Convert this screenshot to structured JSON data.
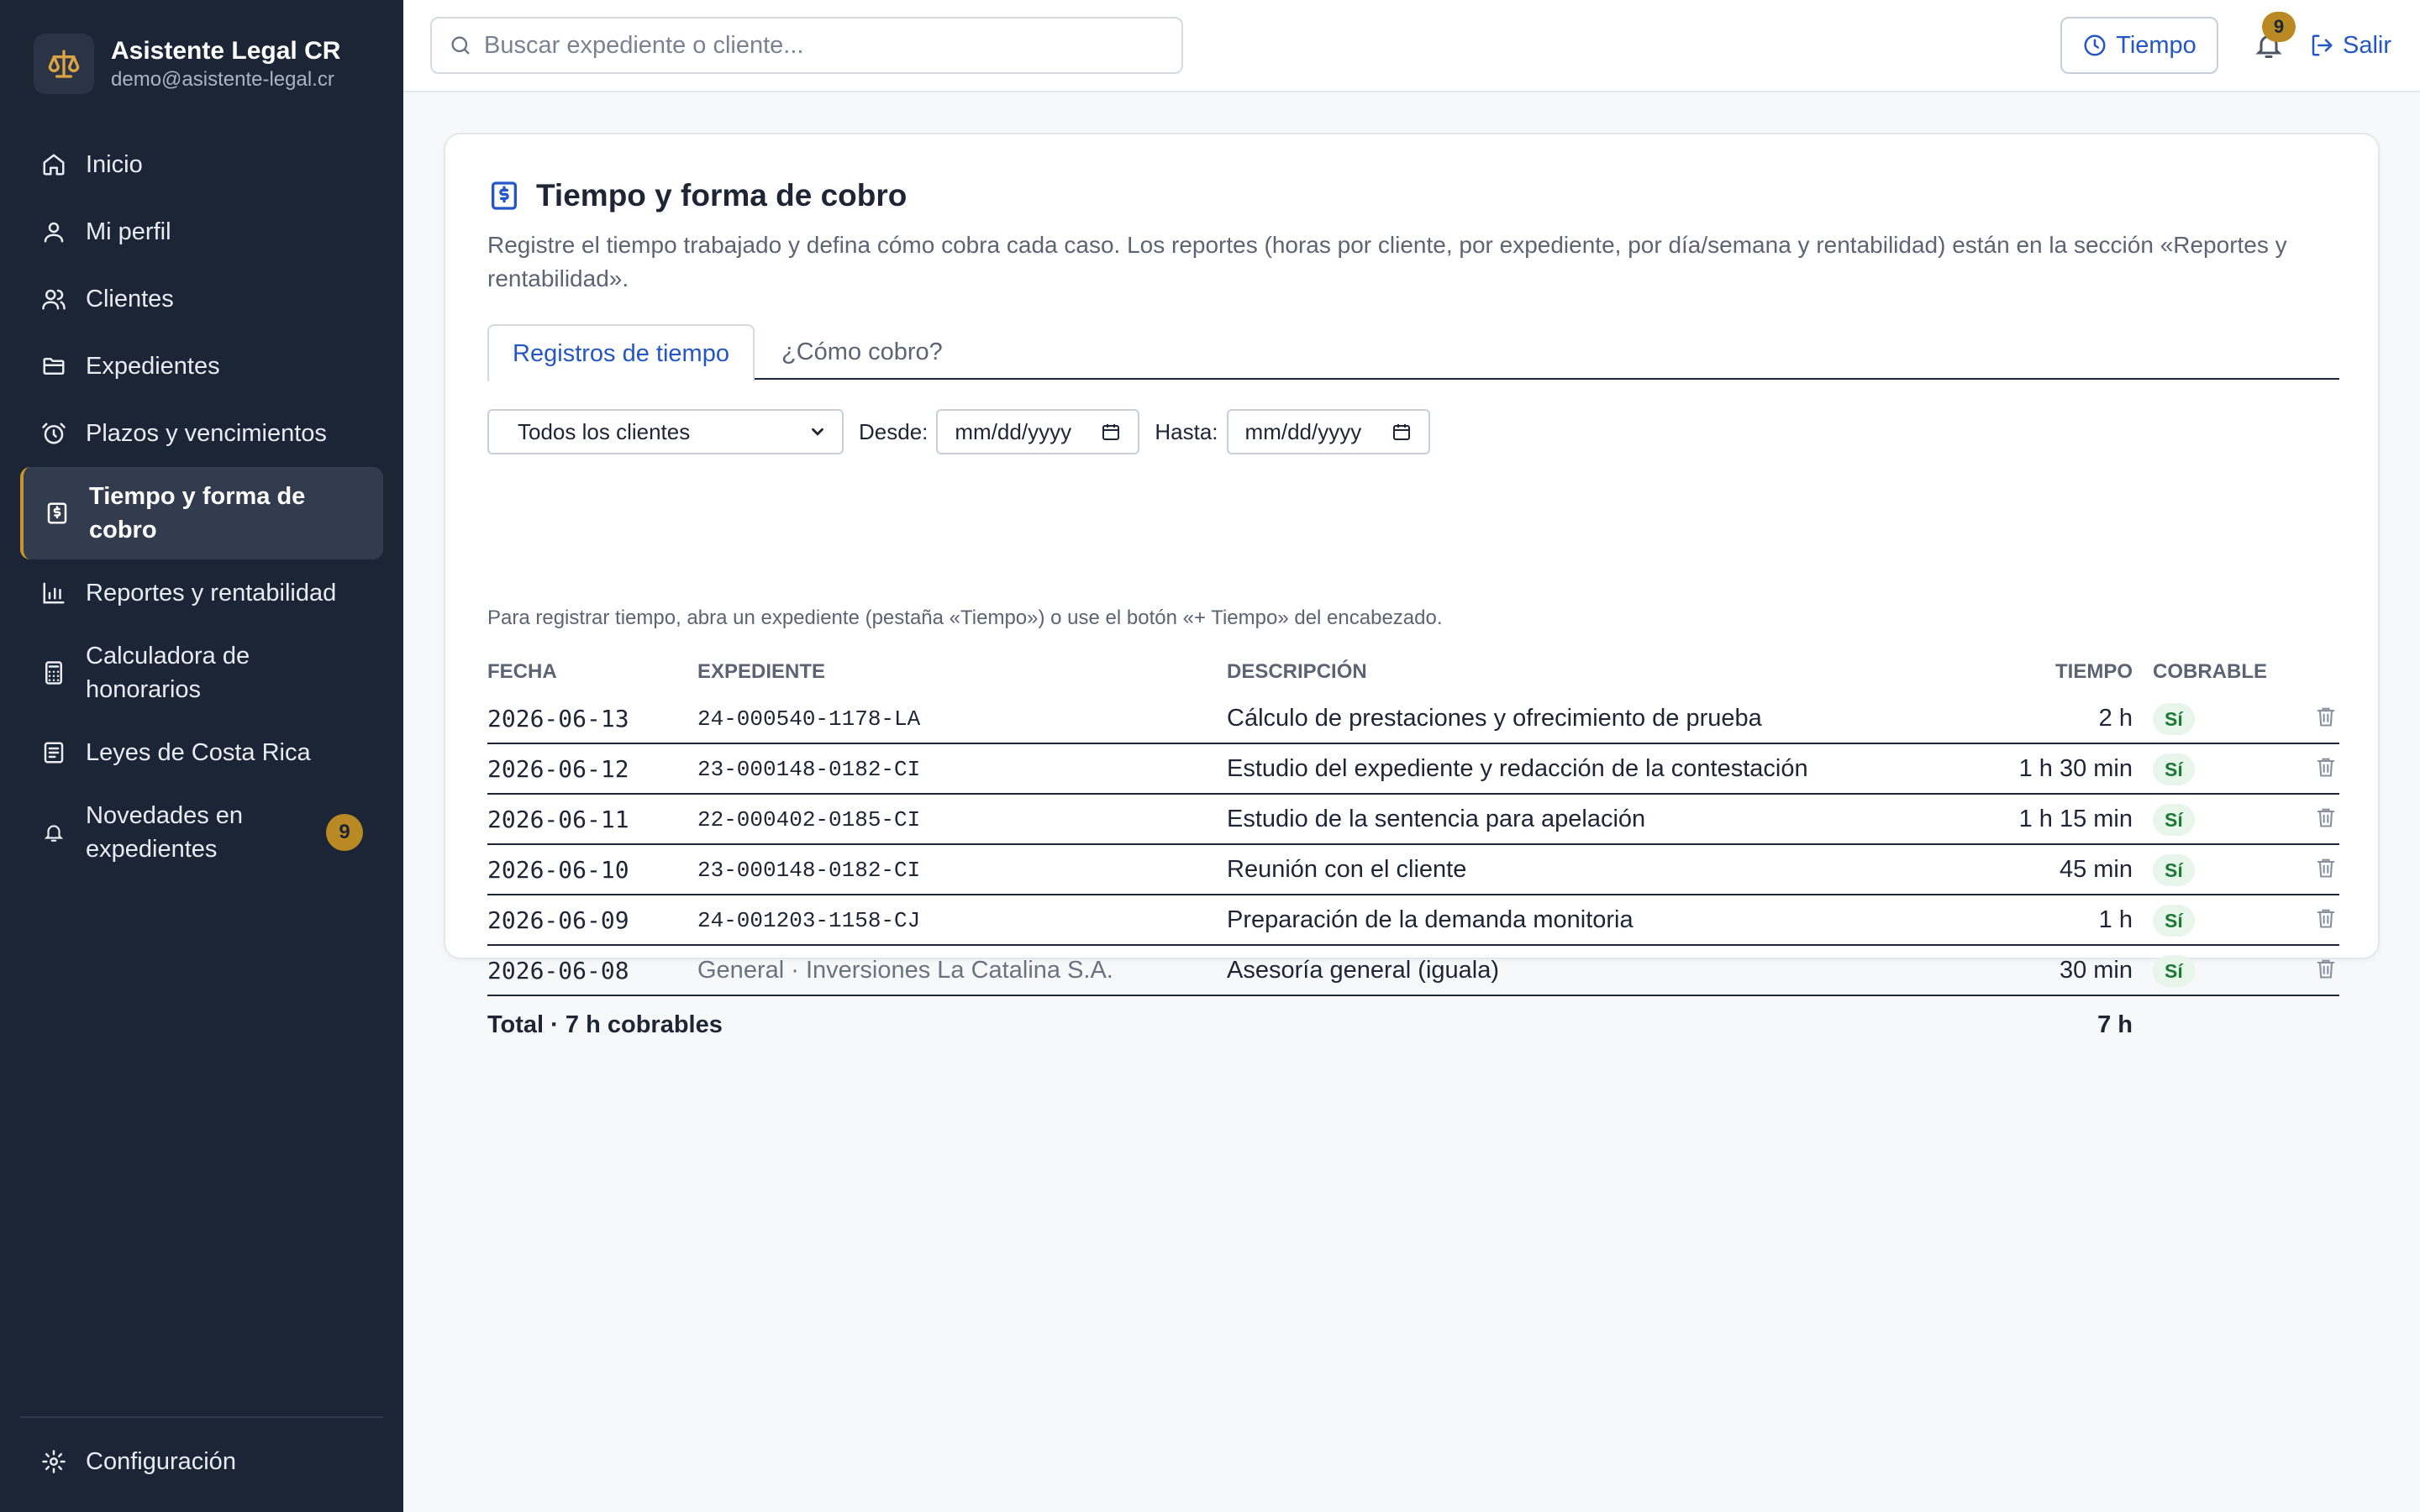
{
  "colors": {
    "sidebar_bg": "#1c2536",
    "accent_gold": "#b98a24",
    "link_blue": "#2457c5",
    "billable_green": "#1d7a34"
  },
  "brand": {
    "title": "Asistente Legal CR",
    "email": "demo@asistente-legal.cr",
    "icon": "scales-icon"
  },
  "sidebar": {
    "items": [
      {
        "label": "Inicio",
        "icon": "home-icon"
      },
      {
        "label": "Mi perfil",
        "icon": "user-icon"
      },
      {
        "label": "Clientes",
        "icon": "users-icon"
      },
      {
        "label": "Expedientes",
        "icon": "folder-icon"
      },
      {
        "label": "Plazos y vencimientos",
        "icon": "alarm-icon"
      },
      {
        "label": "Tiempo y forma de cobro",
        "icon": "receipt-icon",
        "active": true
      },
      {
        "label": "Reportes y rentabilidad",
        "icon": "bar-chart-icon"
      },
      {
        "label": "Calculadora de honorarios",
        "icon": "calculator-icon"
      },
      {
        "label": "Leyes de Costa Rica",
        "icon": "book-icon"
      },
      {
        "label": "Novedades en expedientes",
        "icon": "bell-icon",
        "badge": "9"
      }
    ],
    "settings": {
      "label": "Configuración",
      "icon": "gear-icon"
    }
  },
  "topbar": {
    "search_placeholder": "Buscar expediente o cliente...",
    "tiempo_label": "Tiempo",
    "notifications_count": "9",
    "salir_label": "Salir"
  },
  "page": {
    "title": "Tiempo y forma de cobro",
    "description": "Registre el tiempo trabajado y defina cómo cobra cada caso. Los reportes (horas por cliente, por expediente, por día/semana y rentabilidad) están en la sección «Reportes y rentabilidad».",
    "tabs": [
      {
        "label": "Registros de tiempo",
        "active": true
      },
      {
        "label": "¿Cómo cobro?"
      }
    ],
    "filters": {
      "client_select": "Todos los clientes",
      "desde_label": "Desde:",
      "hasta_label": "Hasta:",
      "date_placeholder": "mm/dd/yyyy"
    },
    "hint": "Para registrar tiempo, abra un expediente (pestaña «Tiempo») o use el botón «+ Tiempo» del encabezado."
  },
  "table": {
    "headers": {
      "fecha": "FECHA",
      "expediente": "EXPEDIENTE",
      "descripcion": "DESCRIPCIÓN",
      "tiempo": "TIEMPO",
      "cobrable": "COBRABLE"
    },
    "rows": [
      {
        "fecha": "2026-06-13",
        "expediente": "24-000540-1178-LA",
        "descripcion": "Cálculo de prestaciones y ofrecimiento de prueba",
        "tiempo": "2 h",
        "cobrable": "Sí"
      },
      {
        "fecha": "2026-06-12",
        "expediente": "23-000148-0182-CI",
        "descripcion": "Estudio del expediente y redacción de la contestación",
        "tiempo": "1 h 30 min",
        "cobrable": "Sí"
      },
      {
        "fecha": "2026-06-11",
        "expediente": "22-000402-0185-CI",
        "descripcion": "Estudio de la sentencia para apelación",
        "tiempo": "1 h 15 min",
        "cobrable": "Sí"
      },
      {
        "fecha": "2026-06-10",
        "expediente": "23-000148-0182-CI",
        "descripcion": "Reunión con el cliente",
        "tiempo": "45 min",
        "cobrable": "Sí"
      },
      {
        "fecha": "2026-06-09",
        "expediente": "24-001203-1158-CJ",
        "descripcion": "Preparación de la demanda monitoria",
        "tiempo": "1 h",
        "cobrable": "Sí"
      },
      {
        "fecha": "2026-06-08",
        "expediente": "General · Inversiones La Catalina S.A.",
        "descripcion": "Asesoría general (iguala)",
        "tiempo": "30 min",
        "cobrable": "Sí"
      }
    ],
    "total_label": "Total · 7 h cobrables",
    "total_value": "7 h"
  }
}
